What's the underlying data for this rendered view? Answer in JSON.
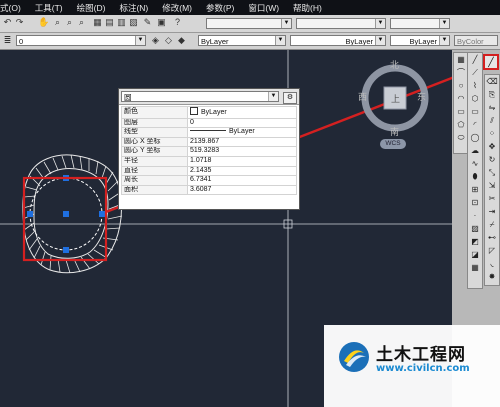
{
  "menu": [
    "式(O)",
    "工具(T)",
    "绘图(D)",
    "标注(N)",
    "修改(M)",
    "参数(P)",
    "窗口(W)",
    "帮助(H)"
  ],
  "toolbar": {
    "layer_value": "0",
    "color_value": "ByLayer",
    "linetype_value": "ByLayer",
    "lineweight_value": "ByLayer",
    "plotstyle_value": "ByColor"
  },
  "viewcube": {
    "north": "北",
    "south": "南",
    "east": "东",
    "west": "西",
    "top_face": "上",
    "wcs": "WCS"
  },
  "properties_panel": {
    "selected_object": "圆",
    "rows": [
      {
        "label": "颜色",
        "value": "ByLayer"
      },
      {
        "label": "图层",
        "value": "0"
      },
      {
        "label": "线型",
        "value": "ByLayer"
      },
      {
        "label": "圆心 X 坐标",
        "value": "2139.867"
      },
      {
        "label": "圆心 Y 坐标",
        "value": "519.3283"
      },
      {
        "label": "半径",
        "value": "1.0718"
      },
      {
        "label": "直径",
        "value": "2.1435"
      },
      {
        "label": "周长",
        "value": "6.7341"
      },
      {
        "label": "面积",
        "value": "3.6087"
      }
    ]
  },
  "watermark": {
    "title": "土木工程网",
    "url": "www.civilcn.com"
  },
  "colors": {
    "canvas": "#212836",
    "annotation_red": "#d42020",
    "grip_blue": "#1f6fe0"
  }
}
